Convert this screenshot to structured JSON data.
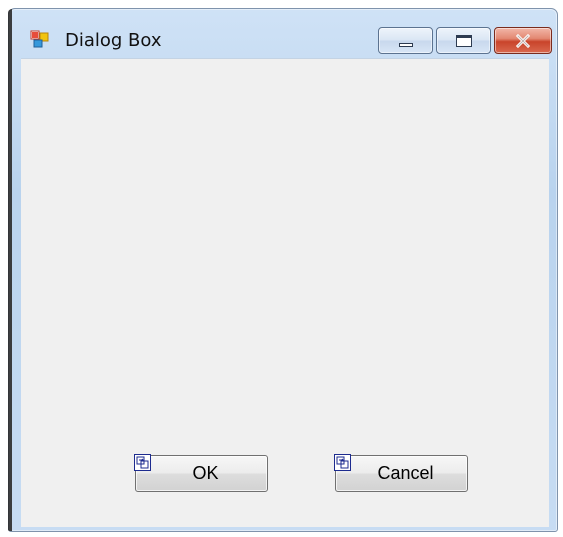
{
  "window": {
    "title": "Dialog Box",
    "app_icon": "windows-form-icon",
    "caption_buttons": {
      "minimize_icon": "minimize-icon",
      "maximize_icon": "maximize-icon",
      "close_icon": "close-icon"
    }
  },
  "form": {
    "buttons": {
      "ok_label": "OK",
      "cancel_label": "Cancel"
    },
    "button_marker_icon": "tab-order-marker-icon"
  },
  "colors": {
    "client_background": "#f0f0f0",
    "window_frame": "#b9d3ee",
    "close_button": "#c9442b"
  }
}
